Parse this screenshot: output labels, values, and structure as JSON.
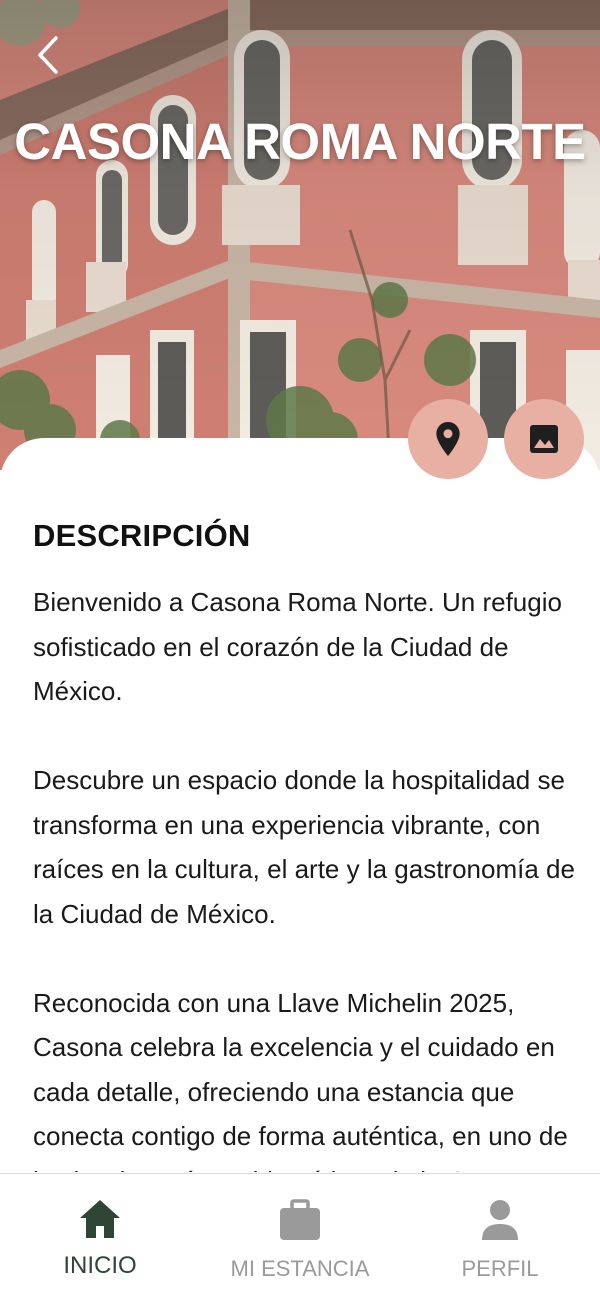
{
  "hero": {
    "title": "CASONA ROMA NORTE",
    "back_icon": "chevron-left-icon"
  },
  "actions": {
    "location_icon": "map-pin-icon",
    "gallery_icon": "image-icon",
    "button_color": "#e8b0a3"
  },
  "description": {
    "heading": "DESCRIPCIÓN",
    "paragraphs": [
      "Bienvenido a Casona Roma Norte. Un refugio sofisticado en el corazón de la Ciudad de México.",
      "Descubre un espacio donde la hospitalidad se transforma en una experiencia vibrante, con raíces en la cultura, el arte y la gastronomía de la Ciudad de México.",
      "Reconocida con una Llave Michelin 2025, Casona celebra la excelencia y el cuidado en cada detalle, ofreciendo una estancia que conecta contigo de forma auténtica, en uno de los barrios más emblemáticos de la CDMX."
    ]
  },
  "bottom_nav": {
    "items": [
      {
        "label": "INICIO",
        "icon": "home-icon",
        "active": true
      },
      {
        "label": "MI ESTANCIA",
        "icon": "briefcase-icon",
        "active": false
      },
      {
        "label": "PERFIL",
        "icon": "person-icon",
        "active": false
      }
    ],
    "active_color": "#2f4536",
    "inactive_color": "#9a9a9a"
  }
}
